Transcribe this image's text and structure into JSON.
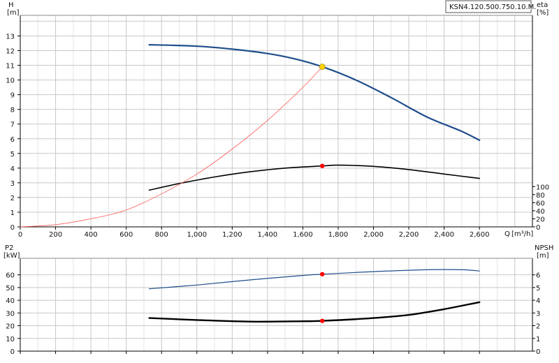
{
  "title": "KSN4.120.500.750.10.M.",
  "chart_data": [
    {
      "type": "line",
      "panel": "head-efficiency",
      "title": "KSN4.120.500.750.10.M.",
      "x_label": "Q",
      "x_unit": "[m³/h]",
      "xlim": [
        0,
        2900
      ],
      "x_ticks": [
        "0",
        "200",
        "400",
        "600",
        "800",
        "1,000",
        "1,200",
        "1,400",
        "1,600",
        "1,800",
        "2,000",
        "2,200",
        "2,400",
        "2,600"
      ],
      "y_left_label": "H",
      "y_left_unit": "[m]",
      "y_left_lim": [
        0,
        14.4
      ],
      "y_left_ticks": [
        "0",
        "1",
        "2",
        "3",
        "4",
        "5",
        "6",
        "7",
        "8",
        "9",
        "10",
        "11",
        "12",
        "13"
      ],
      "y_right_label": "eta",
      "y_right_unit": "[%]",
      "y_right_lim": [
        0,
        525
      ],
      "y_right_ticks": [
        "0",
        "20",
        "40",
        "60",
        "80",
        "100"
      ],
      "grid": true,
      "series": [
        {
          "id": "head",
          "axis": "left",
          "color": "#1f4e8c",
          "x": [
            730,
            1000,
            1200,
            1400,
            1550,
            1710,
            1900,
            2100,
            2300,
            2500,
            2600
          ],
          "y": [
            12.4,
            12.3,
            12.1,
            11.8,
            11.45,
            10.9,
            10.0,
            8.8,
            7.5,
            6.5,
            5.9
          ]
        },
        {
          "id": "efficiency",
          "axis": "right",
          "color": "#000000",
          "x": [
            730,
            900,
            1100,
            1300,
            1500,
            1710,
            1800,
            2000,
            2200,
            2400,
            2600
          ],
          "y": [
            2.5,
            2.95,
            3.4,
            3.75,
            4.0,
            4.15,
            4.2,
            4.12,
            3.9,
            3.6,
            3.3
          ]
        },
        {
          "id": "system",
          "axis": "left",
          "color": "#ff5a5a",
          "x": [
            0,
            200,
            400,
            600,
            800,
            1000,
            1200,
            1400,
            1600,
            1710
          ],
          "y": [
            0,
            0.15,
            0.55,
            1.15,
            2.25,
            3.6,
            5.3,
            7.25,
            9.5,
            10.9
          ]
        }
      ],
      "duty_points": [
        {
          "series": "head",
          "x": 1710,
          "y": 10.9,
          "color": "#ffd400"
        },
        {
          "series": "efficiency",
          "x": 1710,
          "y": 4.15,
          "color": "#ff0000"
        }
      ]
    },
    {
      "type": "line",
      "panel": "power-npsh",
      "xlim": [
        0,
        2900
      ],
      "y_left_label": "P2",
      "y_left_unit": "[kW]",
      "y_left_lim": [
        0,
        73
      ],
      "y_left_ticks": [
        "0",
        "10",
        "20",
        "30",
        "40",
        "50",
        "60"
      ],
      "y_right_label": "NPSH",
      "y_right_unit": "[m]",
      "y_right_lim": [
        0,
        7.3
      ],
      "y_right_ticks": [
        "0",
        "1",
        "2",
        "3",
        "4",
        "5",
        "6"
      ],
      "grid": true,
      "series": [
        {
          "id": "power",
          "axis": "left",
          "color": "#1f4e8c",
          "x": [
            730,
            1000,
            1300,
            1600,
            1710,
            2000,
            2300,
            2500,
            2600
          ],
          "y": [
            49,
            52,
            56,
            59.5,
            60.5,
            62.5,
            64,
            64,
            63
          ]
        },
        {
          "id": "npsh",
          "axis": "right",
          "color": "#000000",
          "x": [
            730,
            1000,
            1300,
            1600,
            1710,
            2000,
            2200,
            2400,
            2600
          ],
          "y": [
            2.6,
            2.45,
            2.32,
            2.35,
            2.38,
            2.6,
            2.85,
            3.3,
            3.85
          ]
        }
      ],
      "duty_points": [
        {
          "series": "power",
          "x": 1710,
          "y": 60.5,
          "color": "#ff0000"
        },
        {
          "series": "npsh",
          "x": 1710,
          "y": 2.38,
          "color": "#ff0000"
        }
      ]
    }
  ]
}
